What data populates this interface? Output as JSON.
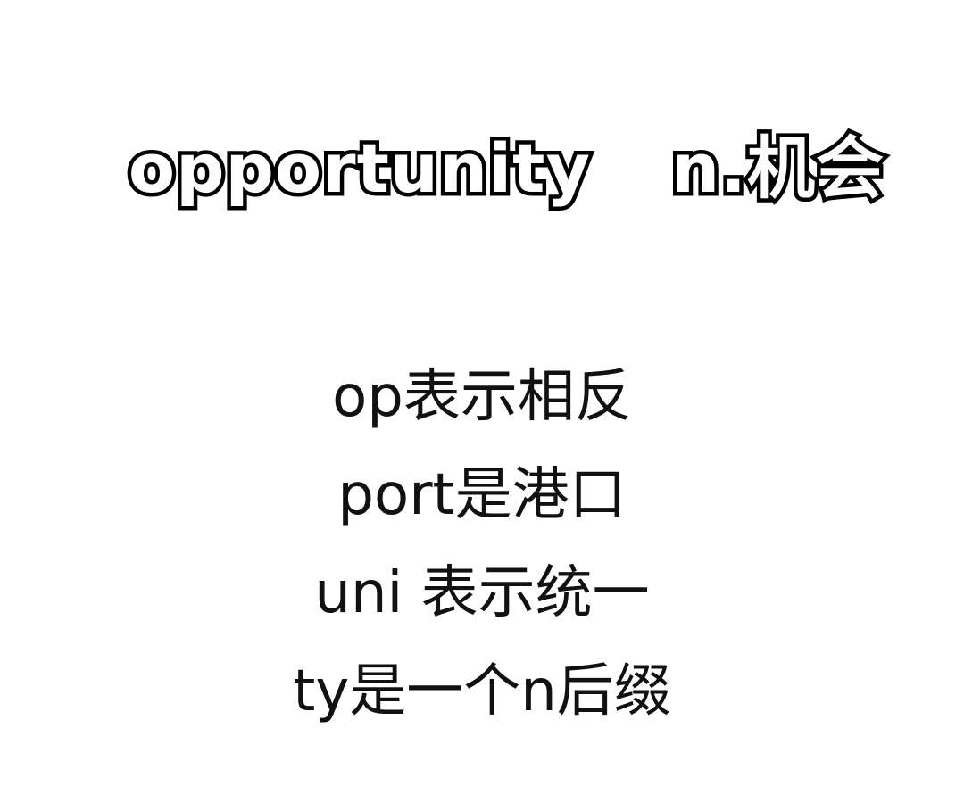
{
  "title": {
    "word": "opportunity",
    "meaning": "n.机会"
  },
  "explanation": [
    "op表示相反",
    "port是港口",
    "uni 表示统一",
    "ty是一个n后缀"
  ]
}
